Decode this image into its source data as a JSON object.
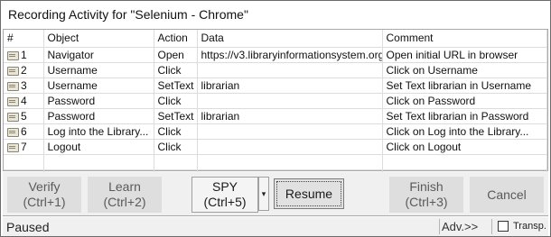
{
  "window": {
    "title": "Recording Activity for \"Selenium - Chrome\""
  },
  "table": {
    "columns": [
      "#",
      "Object",
      "Action",
      "Data",
      "Comment"
    ],
    "rows": [
      {
        "num": "1",
        "object": "Navigator",
        "action": "Open",
        "data": "https://v3.libraryinformationsystem.org",
        "comment": "Open initial URL in browser"
      },
      {
        "num": "2",
        "object": "Username",
        "action": "Click",
        "data": "",
        "comment": "Click on Username"
      },
      {
        "num": "3",
        "object": "Username",
        "action": "SetText",
        "data": "librarian",
        "comment": "Set Text librarian in Username"
      },
      {
        "num": "4",
        "object": "Password",
        "action": "Click",
        "data": "",
        "comment": "Click on Password"
      },
      {
        "num": "5",
        "object": "Password",
        "action": "SetText",
        "data": "librarian",
        "comment": "Set Text librarian in Password"
      },
      {
        "num": "6",
        "object": "Log into the Library...",
        "action": "Click",
        "data": "",
        "comment": "Click on Log into the Library..."
      },
      {
        "num": "7",
        "object": "Logout",
        "action": "Click",
        "data": "",
        "comment": "Click on Logout"
      }
    ]
  },
  "toolbar": {
    "verify": {
      "label": "Verify",
      "shortcut": "(Ctrl+1)"
    },
    "learn": {
      "label": "Learn",
      "shortcut": "(Ctrl+2)"
    },
    "spy": {
      "label": "SPY",
      "shortcut": "(Ctrl+5)",
      "dropdown_glyph": "▾"
    },
    "resume": {
      "label": "Resume"
    },
    "finish": {
      "label": "Finish",
      "shortcut": "(Ctrl+3)"
    },
    "cancel": {
      "label": "Cancel"
    }
  },
  "statusbar": {
    "status": "Paused",
    "advanced": "Adv.>>",
    "transparent_label": "Transp.",
    "transparent_checked": false
  },
  "icons": {
    "row_icon": "step-icon"
  }
}
